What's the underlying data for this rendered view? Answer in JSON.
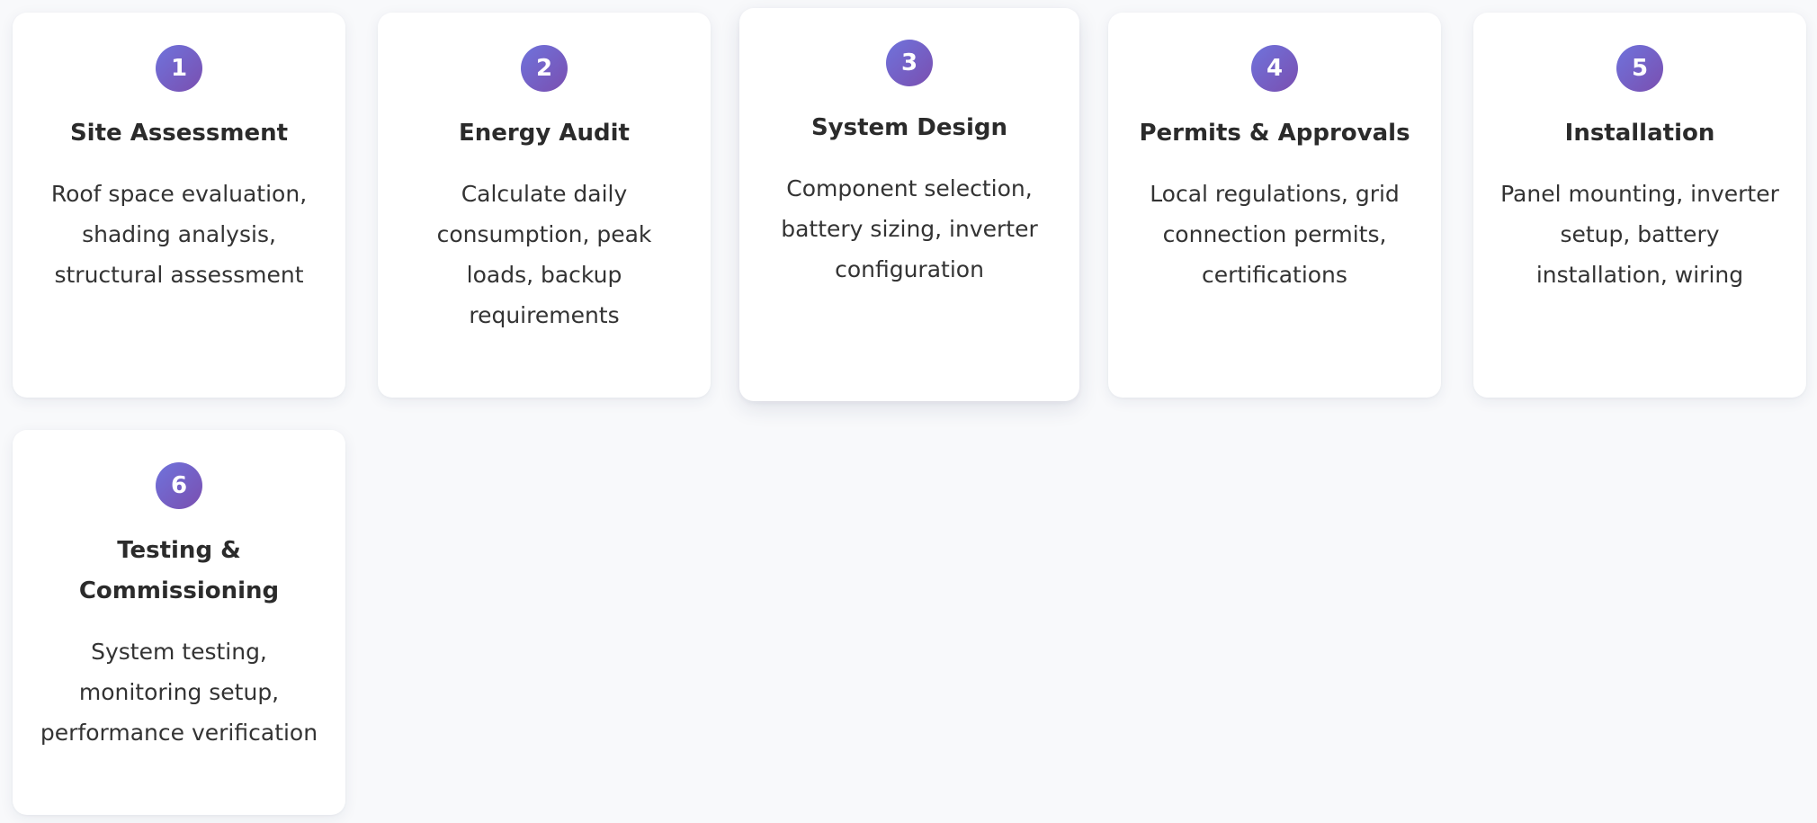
{
  "colors": {
    "page_background": "#f8f9fb",
    "card_background": "#ffffff",
    "badge_gradient_start": "#6f73dc",
    "badge_gradient_end": "#7a4fb0",
    "text": "#2b2b2b"
  },
  "steps": [
    {
      "number": "1",
      "title": "Site Assessment",
      "description": "Roof space evaluation, shading analysis, structural assessment"
    },
    {
      "number": "2",
      "title": "Energy Audit",
      "description": "Calculate daily consumption, peak loads, backup requirements"
    },
    {
      "number": "3",
      "title": "System Design",
      "description": "Component selection, battery sizing, inverter configuration"
    },
    {
      "number": "4",
      "title": "Permits & Approvals",
      "description": "Local regulations, grid connection permits, certifications"
    },
    {
      "number": "5",
      "title": "Installation",
      "description": "Panel mounting, inverter setup, battery installation, wiring"
    },
    {
      "number": "6",
      "title": "Testing & Commissioning",
      "description": "System testing, monitoring setup, performance verification"
    }
  ]
}
